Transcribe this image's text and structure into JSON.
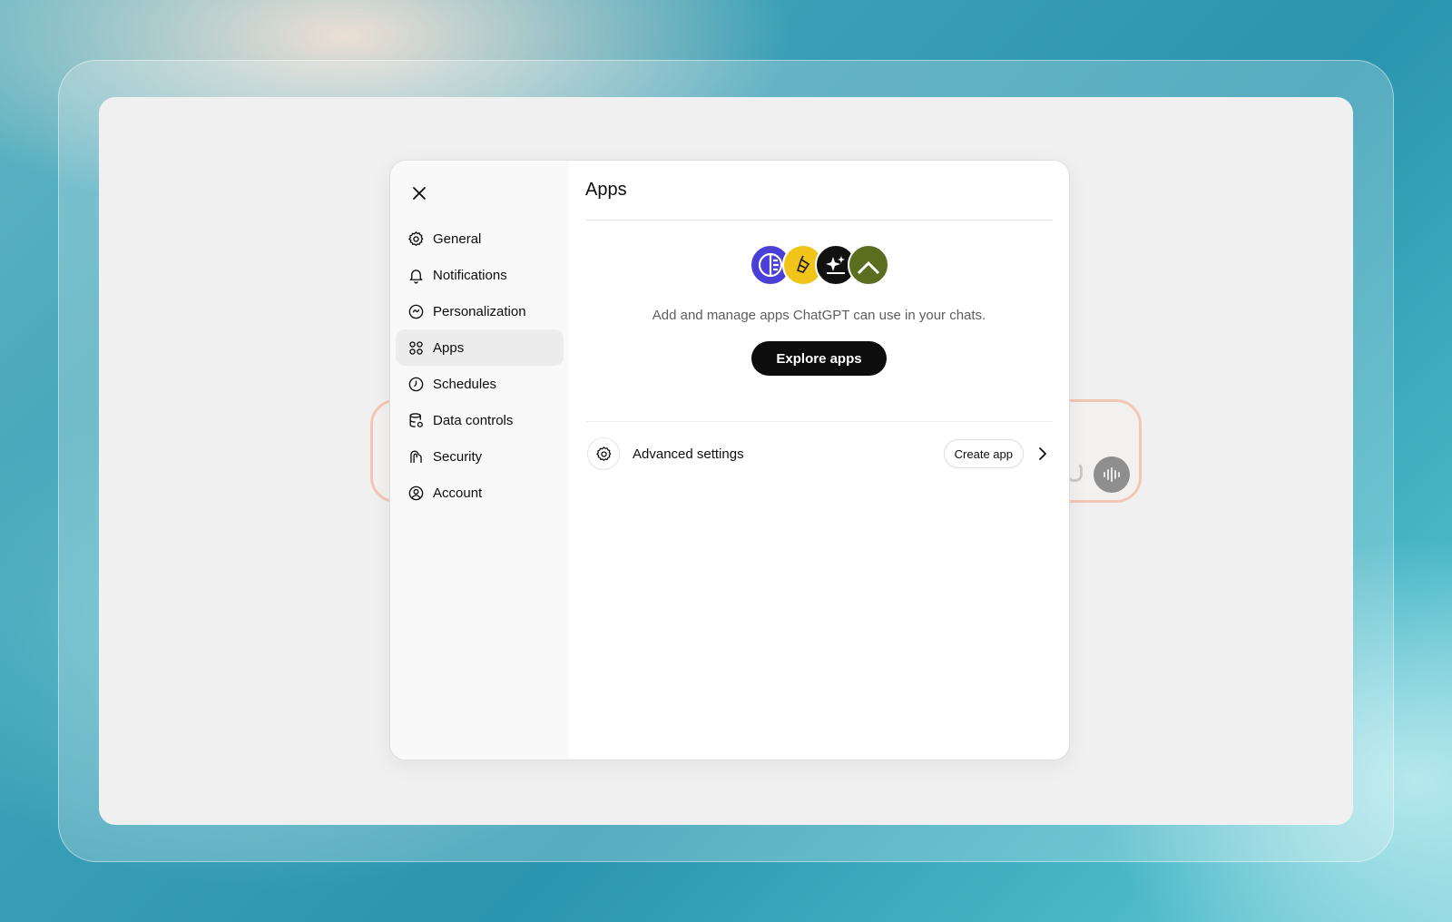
{
  "settings": {
    "nav": [
      {
        "label": "General",
        "icon": "gear-icon"
      },
      {
        "label": "Notifications",
        "icon": "bell-icon"
      },
      {
        "label": "Personalization",
        "icon": "personalization-icon"
      },
      {
        "label": "Apps",
        "icon": "apps-grid-icon",
        "active": true
      },
      {
        "label": "Schedules",
        "icon": "clock-icon"
      },
      {
        "label": "Data controls",
        "icon": "database-icon"
      },
      {
        "label": "Security",
        "icon": "security-icon"
      },
      {
        "label": "Account",
        "icon": "user-circle-icon"
      }
    ],
    "main": {
      "title": "Apps",
      "description": "Add and manage apps ChatGPT can use in your chats.",
      "explore_label": "Explore apps",
      "advanced_label": "Advanced settings",
      "create_label": "Create app"
    },
    "app_icon_colors": [
      "#4a3fd6",
      "#f0c419",
      "#111111",
      "#5b6e1f"
    ]
  }
}
